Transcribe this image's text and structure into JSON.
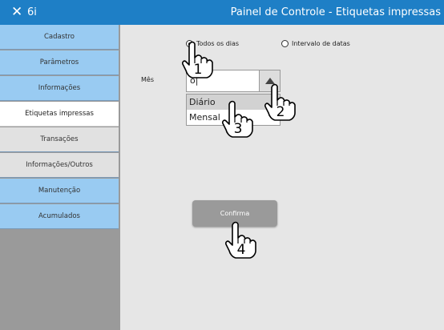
{
  "window": {
    "app_name": "6i",
    "title": "Painel de Controle - Etiquetas impressas",
    "close_icon": "close-icon",
    "titlebar_color": "#1e7fc6"
  },
  "sidebar": {
    "items": [
      {
        "label": "Cadastro",
        "state": "normal"
      },
      {
        "label": "Parâmetros",
        "state": "normal"
      },
      {
        "label": "Informações",
        "state": "normal"
      },
      {
        "label": "Etiquetas impressas",
        "state": "active"
      },
      {
        "label": "Transações",
        "state": "gray"
      },
      {
        "label": "Informações/Outros",
        "state": "gray"
      },
      {
        "label": "Manutenção",
        "state": "normal"
      },
      {
        "label": "Acumulados",
        "state": "normal"
      }
    ],
    "item_color": "#99cbf2",
    "background_color": "#9a9a9a"
  },
  "filters": {
    "radio_all_days": {
      "label": "Todos os dias",
      "selected": true
    },
    "radio_date_range": {
      "label": "Intervalo de datas",
      "selected": false
    }
  },
  "month": {
    "label": "Mês",
    "combo_value": "o|",
    "options": [
      "Diário",
      "Mensal"
    ],
    "highlighted": "Diário"
  },
  "confirm": {
    "label": "Confirma"
  },
  "hand_markers": [
    {
      "number": "1",
      "icon": "hand-pointer-icon"
    },
    {
      "number": "2",
      "icon": "hand-pointer-icon"
    },
    {
      "number": "3",
      "icon": "hand-pointer-icon"
    },
    {
      "number": "4",
      "icon": "hand-pointer-icon"
    }
  ]
}
